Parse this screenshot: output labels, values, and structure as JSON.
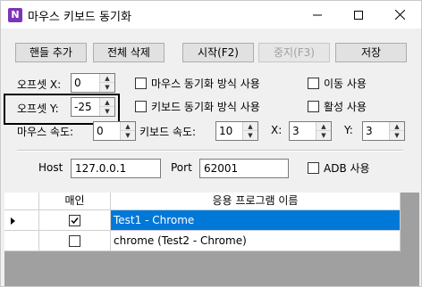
{
  "window": {
    "title": "마우스 키보드 동기화",
    "app_icon_letter": "N",
    "minimize_icon": "minimize-icon",
    "maximize_icon": "maximize-icon",
    "close_icon": "close-icon"
  },
  "toolbar": {
    "add_handle": "핸들 추가",
    "delete_all": "전체 삭제",
    "start": "시작(F2)",
    "stop": "중지(F3)",
    "save": "저장"
  },
  "offset_x": {
    "label": "오프셋 X:",
    "value": "0"
  },
  "offset_y": {
    "label": "오프셋 Y:",
    "value": "-25"
  },
  "mouse_speed": {
    "label": "마우스 속도:",
    "value": "0"
  },
  "keyboard_speed": {
    "label": "키보드 속도:",
    "value": "10"
  },
  "coord_x": {
    "label": "X:",
    "value": "3"
  },
  "coord_y": {
    "label": "Y:",
    "value": "3"
  },
  "options": {
    "mouse_sync": "마우스 동기화 방식 사용",
    "keyboard_sync": "키보드 동기화 방식 사용",
    "move_use": "이동 사용",
    "active_use": "활성 사용",
    "adb_use": "ADB 사용"
  },
  "connection": {
    "host_label": "Host",
    "host_value": "127.0.0.1",
    "port_label": "Port",
    "port_value": "62001"
  },
  "grid": {
    "columns": [
      "매인",
      "응용 프로그램 이름"
    ],
    "rows": [
      {
        "checked": true,
        "name": "Test1 - Chrome",
        "selected": true
      },
      {
        "checked": false,
        "name": "chrome  (Test2 - Chrome)",
        "selected": false
      }
    ]
  },
  "colors": {
    "selection": "#0078d7",
    "app_icon": "#7b35b5"
  }
}
